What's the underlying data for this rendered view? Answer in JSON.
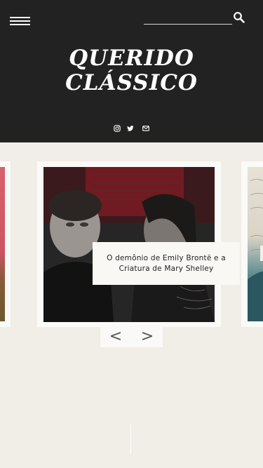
{
  "header": {
    "logo": {
      "line1": "QUERIDO",
      "line2": "CLÁSSICO"
    },
    "menu_icon": "hamburger-menu-icon",
    "search": {
      "value": "",
      "placeholder": "",
      "icon": "search-icon"
    },
    "social": [
      {
        "name": "instagram",
        "icon": "instagram-icon"
      },
      {
        "name": "twitter",
        "icon": "twitter-icon"
      },
      {
        "name": "email",
        "icon": "envelope-icon"
      }
    ]
  },
  "carousel": {
    "active_caption": "O demônio de Emily Brontë e a Criatura de Mary Shelley",
    "prev_label": "<",
    "next_label": ">"
  },
  "colors": {
    "header_bg": "#222222",
    "page_bg": "#f1ede7",
    "card_bg": "#fafaf8"
  }
}
